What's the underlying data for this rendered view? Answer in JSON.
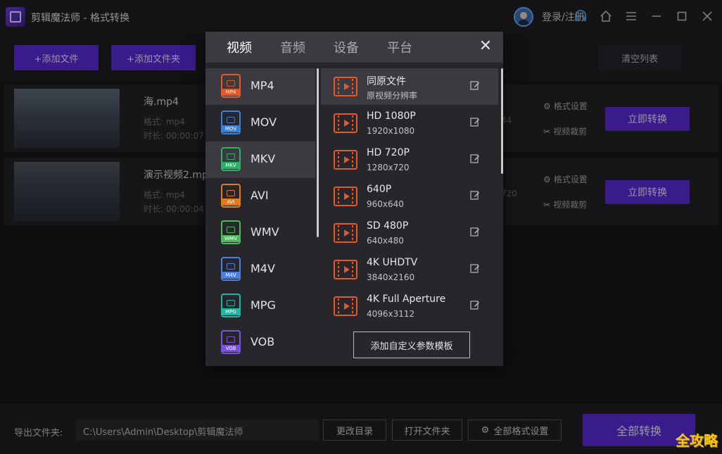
{
  "app": {
    "title": "剪辑魔法师 - 格式转换",
    "login_text": "登录/注册"
  },
  "toolbar": {
    "add_file": "+添加文件",
    "add_folder": "+添加文件夹",
    "clear_list": "清空列表"
  },
  "files": [
    {
      "name": "海.mp4",
      "format_line": "格式: mp4",
      "duration_line": "时长: 00:00:07",
      "right_meta": "44",
      "opt_format": "格式设置",
      "opt_trim": "视频裁剪",
      "convert": "立即转换"
    },
    {
      "name": "演示视频2.mp4",
      "format_line": "格式: mp4",
      "duration_line": "时长: 00:00:04",
      "right_meta": "720",
      "opt_format": "格式设置",
      "opt_trim": "视频裁剪",
      "convert": "立即转换"
    }
  ],
  "bottom": {
    "label": "导出文件夹:",
    "path": "C:\\Users\\Admin\\Desktop\\剪辑魔法师",
    "change_dir": "更改目录",
    "open_folder": "打开文件夹",
    "all_format": "全部格式设置",
    "convert_all": "全部转换"
  },
  "watermark": "全攻略",
  "dialog": {
    "tabs": [
      "视频",
      "音频",
      "设备",
      "平台"
    ],
    "active_tab": "视频",
    "formats": [
      {
        "name": "MP4",
        "tag": "MP4",
        "color": "#e25a2a"
      },
      {
        "name": "MOV",
        "tag": "MOV",
        "color": "#3a7fd8"
      },
      {
        "name": "MKV",
        "tag": "MKV",
        "color": "#2fb16a"
      },
      {
        "name": "AVI",
        "tag": "AVI",
        "color": "#e07a1a"
      },
      {
        "name": "WMV",
        "tag": "WMV",
        "color": "#4cba5a"
      },
      {
        "name": "M4V",
        "tag": "M4V",
        "color": "#4b7fe0"
      },
      {
        "name": "MPG",
        "tag": "MPG",
        "color": "#1fb5a5"
      },
      {
        "name": "VOB",
        "tag": "VOB",
        "color": "#7b4fe0"
      }
    ],
    "selected_format": "MKV",
    "presets": [
      {
        "name": "同原文件",
        "res": "原视频分辨率"
      },
      {
        "name": "HD 1080P",
        "res": "1920x1080"
      },
      {
        "name": "HD 720P",
        "res": "1280x720"
      },
      {
        "name": "640P",
        "res": "960x640"
      },
      {
        "name": "SD 480P",
        "res": "640x480"
      },
      {
        "name": "4K UHDTV",
        "res": "3840x2160"
      },
      {
        "name": "4K Full Aperture",
        "res": "4096x3112"
      }
    ],
    "custom_button": "添加自定义参数模板"
  }
}
